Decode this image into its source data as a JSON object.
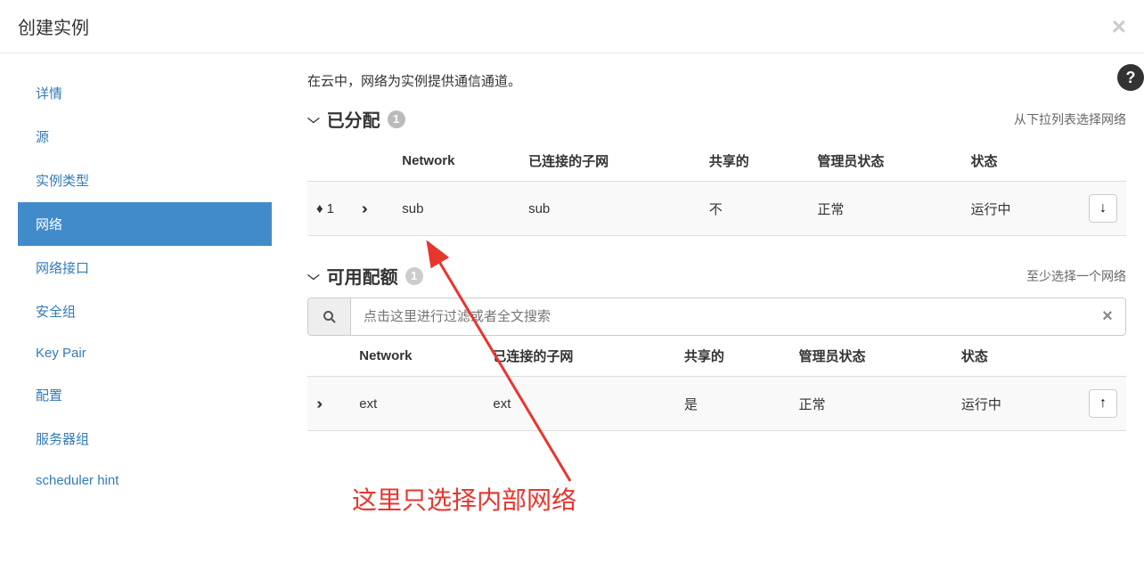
{
  "modal": {
    "title": "创建实例"
  },
  "sidebar": {
    "items": [
      {
        "label": "详情"
      },
      {
        "label": "源"
      },
      {
        "label": "实例类型"
      },
      {
        "label": "网络"
      },
      {
        "label": "网络接口"
      },
      {
        "label": "安全组"
      },
      {
        "label": "Key Pair"
      },
      {
        "label": "配置"
      },
      {
        "label": "服务器组"
      },
      {
        "label": "scheduler hint"
      }
    ]
  },
  "content": {
    "intro": "在云中，网络为实例提供通信通道。",
    "allocated": {
      "title": "已分配",
      "count": "1",
      "helper": "从下拉列表选择网络",
      "headers": {
        "network": "Network",
        "subnet": "已连接的子网",
        "shared": "共享的",
        "admin": "管理员状态",
        "status": "状态"
      },
      "rows": [
        {
          "order": "1",
          "network": "sub",
          "subnet": "sub",
          "shared": "不",
          "admin": "正常",
          "status": "运行中"
        }
      ]
    },
    "available": {
      "title": "可用配额",
      "count": "1",
      "helper": "至少选择一个网络",
      "filter_placeholder": "点击这里进行过滤或者全文搜索",
      "headers": {
        "network": "Network",
        "subnet": "已连接的子网",
        "shared": "共享的",
        "admin": "管理员状态",
        "status": "状态"
      },
      "rows": [
        {
          "network": "ext",
          "subnet": "ext",
          "shared": "是",
          "admin": "正常",
          "status": "运行中"
        }
      ]
    }
  },
  "annotation": {
    "text": "这里只选择内部网络"
  }
}
